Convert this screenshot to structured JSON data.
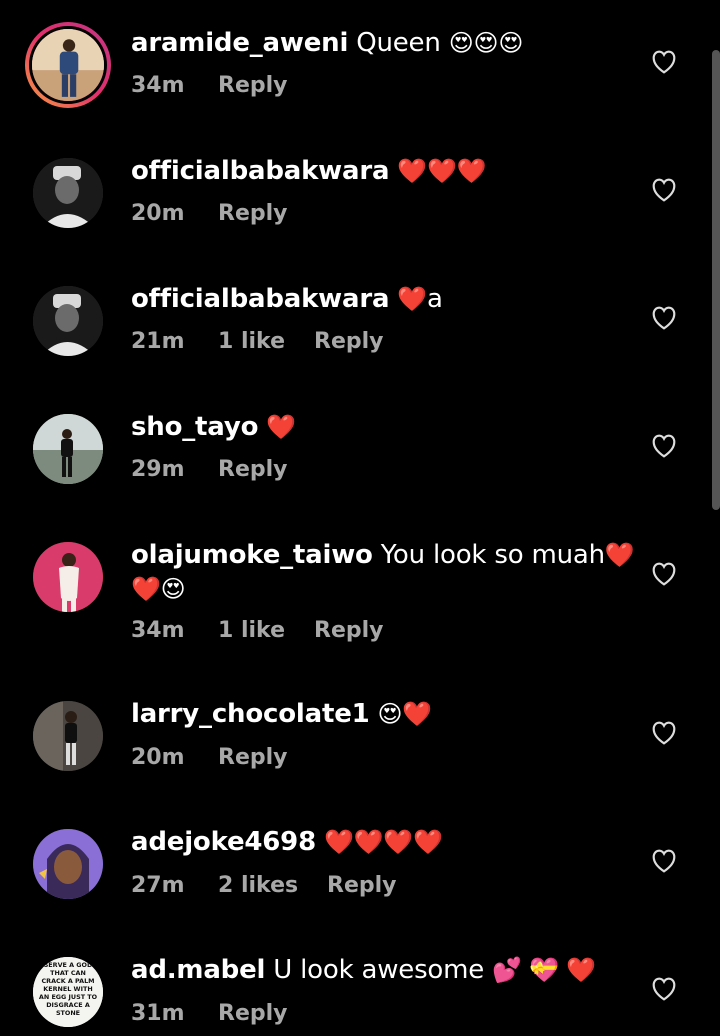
{
  "comments": [
    {
      "username": "aramide_aweni",
      "text": "Queen",
      "emojis": "😍😍😍",
      "time": "34m",
      "likes": "",
      "reply": "Reply",
      "avatar": "person-standing-photo"
    },
    {
      "username": "officialbabakwara",
      "text": "",
      "emojis": "❤️❤️❤️",
      "time": "20m",
      "likes": "",
      "reply": "Reply",
      "avatar": "man-in-cap-bw-photo"
    },
    {
      "username": "officialbabakwara",
      "text": "a",
      "emojis": "❤️",
      "time": "21m",
      "likes": "1 like",
      "reply": "Reply",
      "avatar": "man-in-cap-bw-photo"
    },
    {
      "username": "sho_tayo",
      "text": "",
      "emojis": "❤️",
      "time": "29m",
      "likes": "",
      "reply": "Reply",
      "avatar": "person-outdoors-photo"
    },
    {
      "username": "olajumoke_taiwo",
      "text": "You look so muah",
      "emojis": "❤️",
      "text2": "❤️😍",
      "time": "34m",
      "likes": "1 like",
      "reply": "Reply",
      "avatar": "woman-pink-background-photo"
    },
    {
      "username": "larry_chocolate1",
      "text": "",
      "emojis": "😍❤️",
      "time": "20m",
      "likes": "",
      "reply": "Reply",
      "avatar": "person-indoors-photo"
    },
    {
      "username": "adejoke4698",
      "text": "",
      "emojis": "❤️❤️❤️❤️",
      "time": "27m",
      "likes": "2 likes",
      "reply": "Reply",
      "avatar": "woman-selfie-photo"
    },
    {
      "username": "ad.mabel",
      "text": "U look awesome",
      "emojis": "💕 💝 ❤️",
      "time": "31m",
      "likes": "",
      "reply": "Reply",
      "avatar": "meme-text-image",
      "avatar_text": "SERVE A GOD THAT CAN CRACK A PALM KERNEL WITH AN EGG JUST TO DISGRACE A STONE"
    }
  ],
  "colors": {
    "background": "#000000",
    "text": "#ffffff",
    "meta": "#a8a8a8"
  }
}
